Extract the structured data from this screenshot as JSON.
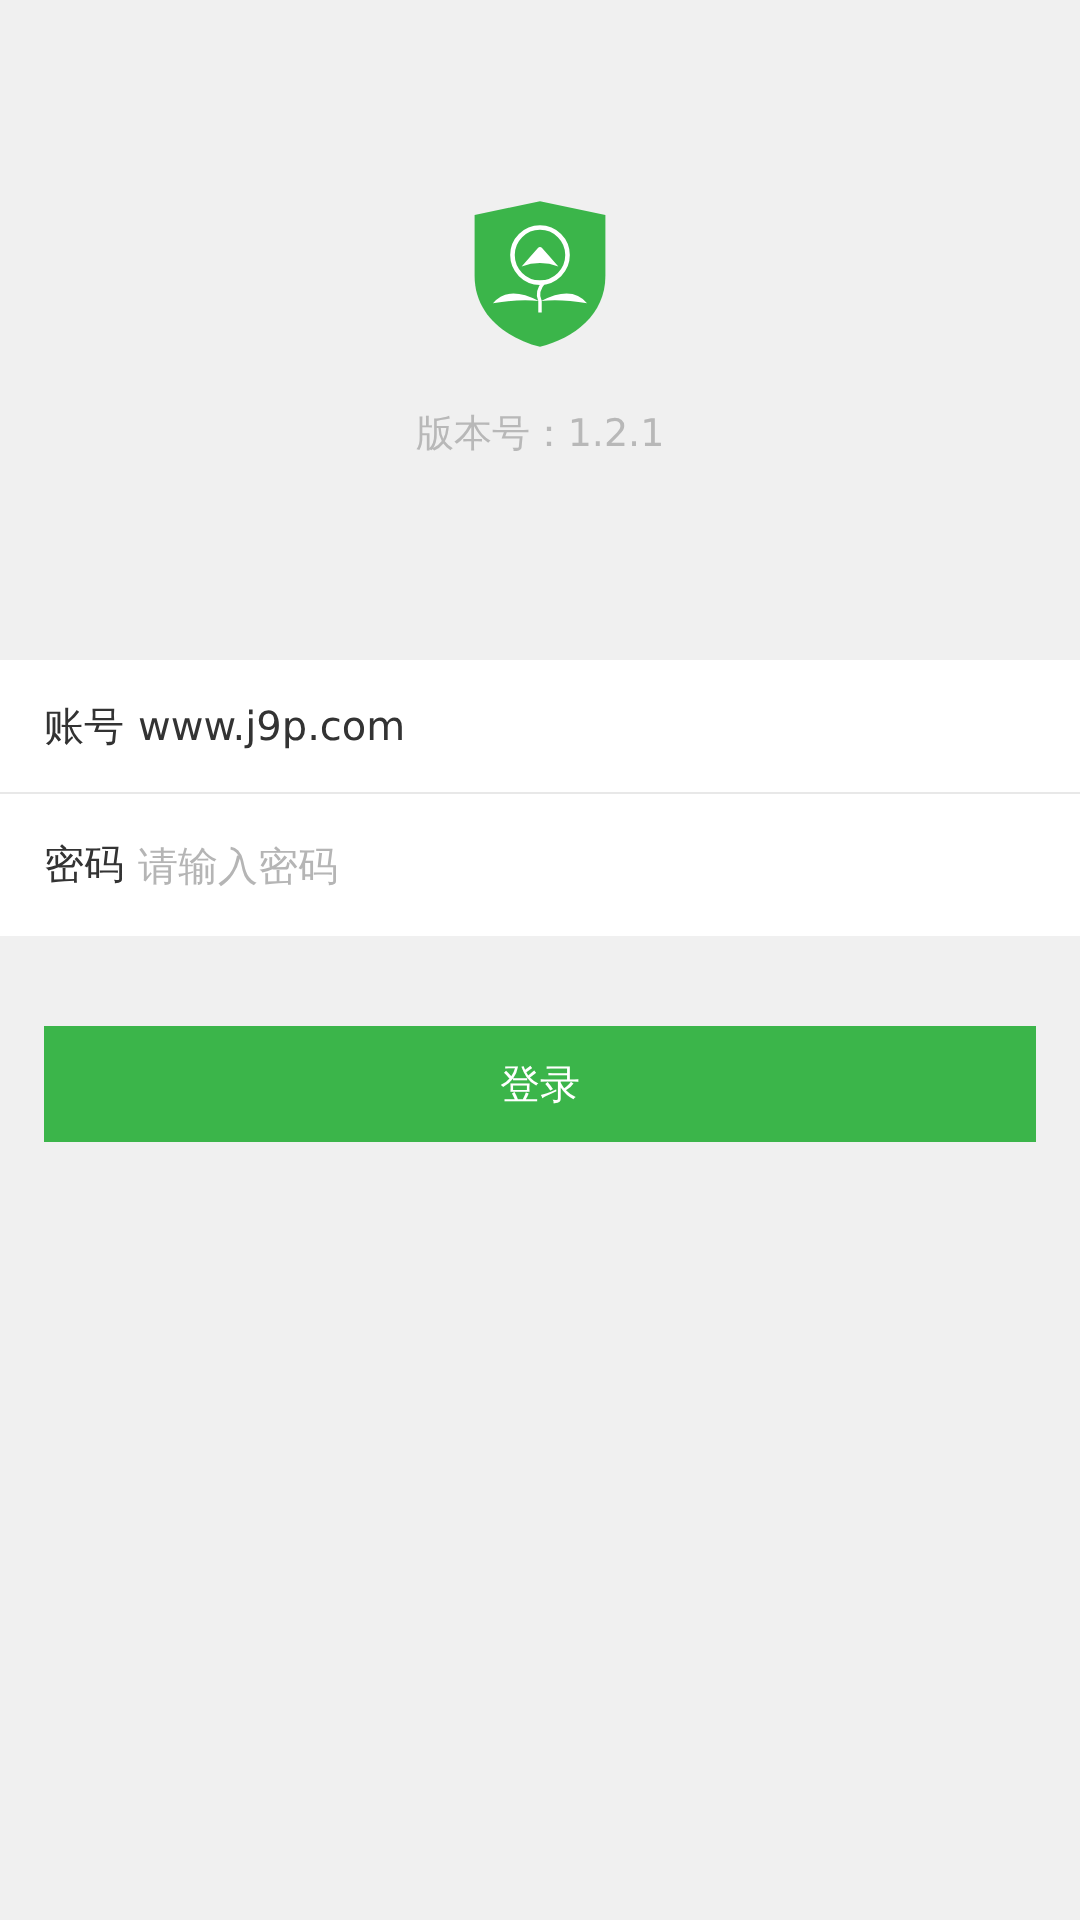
{
  "version_label": "版本号：1.2.1",
  "fields": [
    {
      "label": "账号",
      "value": "www.j9p.com",
      "kind": "text"
    },
    {
      "label": "密码",
      "placeholder": "请输入密码",
      "kind": "password"
    }
  ],
  "login_button": "登录"
}
